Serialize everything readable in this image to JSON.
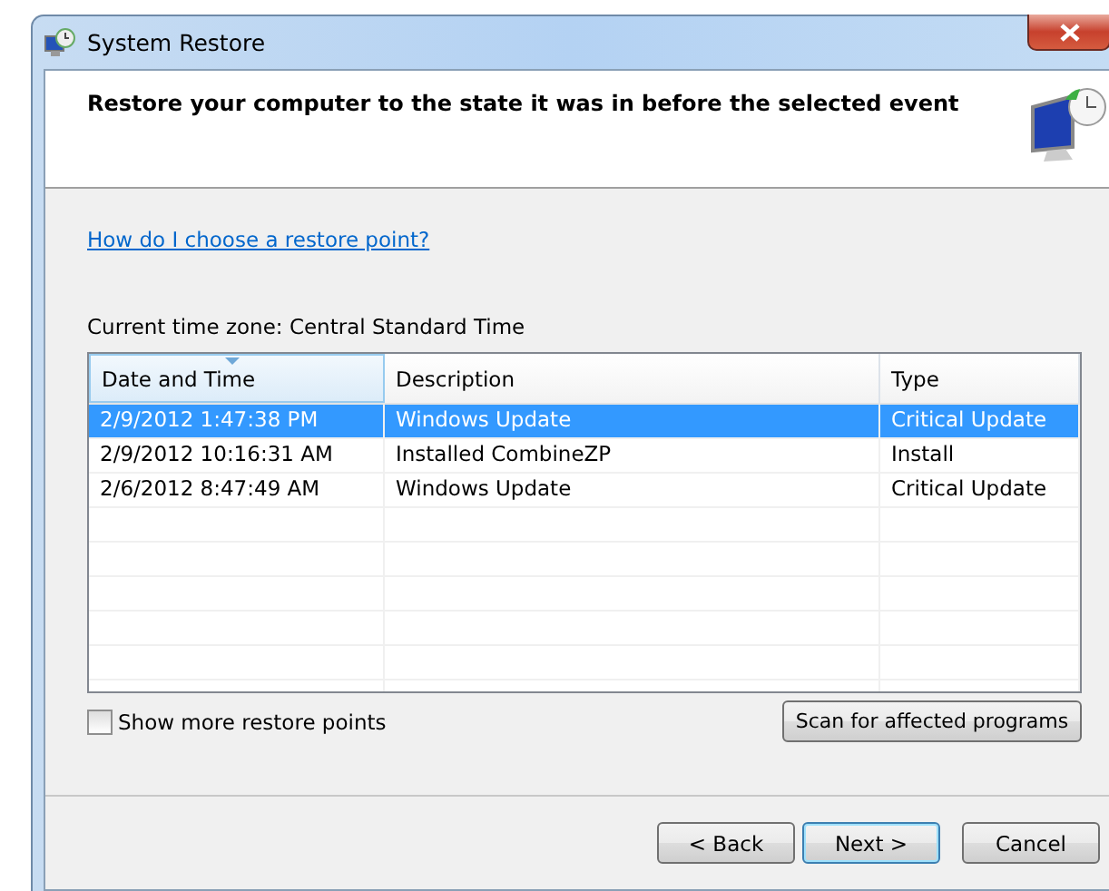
{
  "window": {
    "title": "System Restore"
  },
  "header": {
    "heading": "Restore your computer to the state it was in before the selected event"
  },
  "help_link": "How do I choose a restore point?",
  "time_zone": "Current time zone: Central Standard Time",
  "table": {
    "columns": [
      {
        "label": "Date and Time",
        "sorted": true
      },
      {
        "label": "Description",
        "sorted": false
      },
      {
        "label": "Type",
        "sorted": false
      }
    ],
    "rows": [
      {
        "cells": [
          "2/9/2012 1:47:38 PM",
          "Windows Update",
          "Critical Update"
        ],
        "selected": true
      },
      {
        "cells": [
          "2/9/2012 10:16:31 AM",
          "Installed CombineZP",
          "Install"
        ],
        "selected": false
      },
      {
        "cells": [
          "2/6/2012 8:47:49 AM",
          "Windows Update",
          "Critical Update"
        ],
        "selected": false
      }
    ]
  },
  "show_more": {
    "label": "Show more restore points",
    "checked": false
  },
  "scan_button": "Scan for affected programs",
  "buttons": [
    {
      "label": "< Back",
      "default": false
    },
    {
      "label": "Next >",
      "default": true
    },
    {
      "label": "Cancel",
      "default": false
    }
  ]
}
